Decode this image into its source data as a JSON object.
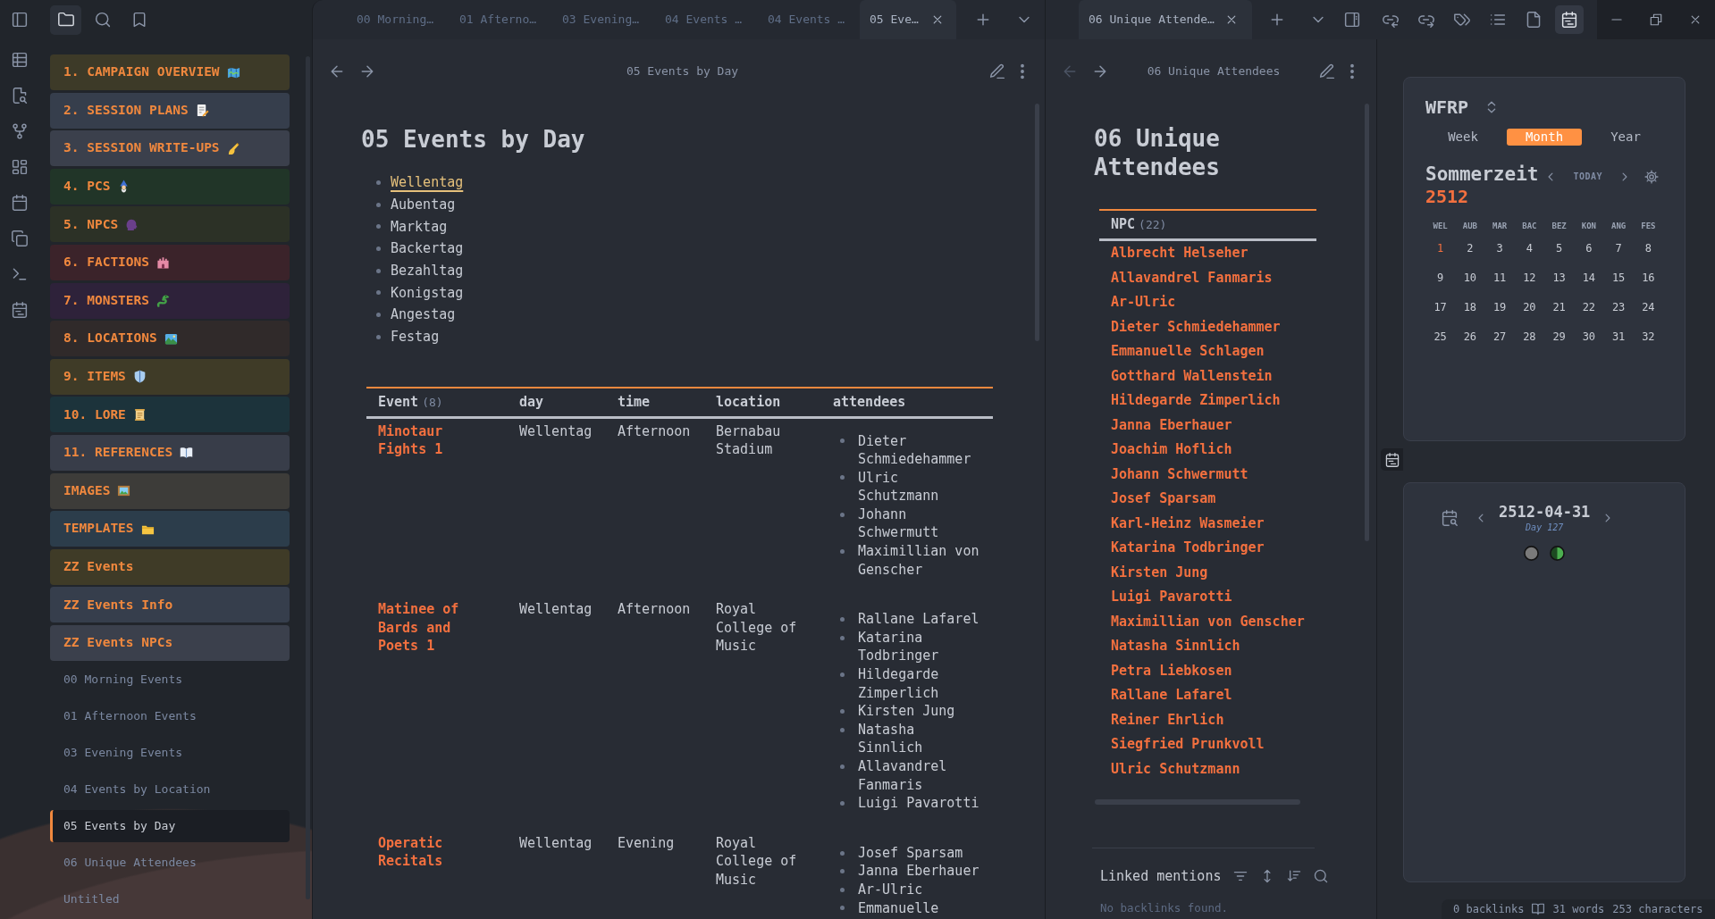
{
  "sidebar_tabs": [
    {
      "kind": "files",
      "selected": true
    },
    {
      "kind": "search",
      "selected": false
    },
    {
      "kind": "bookmarks",
      "selected": false
    }
  ],
  "sidebar": {
    "folders": [
      {
        "label": "1. CAMPAIGN OVERVIEW",
        "color": "#3d3a28"
      },
      {
        "label": "2. SESSION PLANS",
        "color": "#363e4c"
      },
      {
        "label": "3. SESSION WRITE-UPS",
        "color": "#3b404c"
      },
      {
        "label": "4. PCS",
        "color": "#213528"
      },
      {
        "label": "5. NPCS",
        "color": "#2c3126"
      },
      {
        "label": "6. FACTIONS",
        "color": "#3b232a"
      },
      {
        "label": "7. MONSTERS",
        "color": "#2e223a"
      },
      {
        "label": "8. LOCATIONS",
        "color": "#302a2a"
      },
      {
        "label": "9. ITEMS",
        "color": "#3f3b27"
      },
      {
        "label": "10. LORE",
        "color": "#1c333b"
      },
      {
        "label": "11. REFERENCES",
        "color": "#383d49"
      },
      {
        "label": "IMAGES",
        "color": "#3d3c39"
      },
      {
        "label": "TEMPLATES",
        "color": "#2c3d4b"
      },
      {
        "label": "ZZ Events",
        "color": "#3f3b27"
      },
      {
        "label": "ZZ Events Info",
        "color": "#363e4c"
      },
      {
        "label": "ZZ Events NPCs",
        "color": "#3b404c"
      }
    ],
    "files": [
      {
        "label": "00 Morning Events",
        "selected": false
      },
      {
        "label": "01 Afternoon Events",
        "selected": false
      },
      {
        "label": "03 Evening Events",
        "selected": false
      },
      {
        "label": "04 Events by Location",
        "selected": false
      },
      {
        "label": "05 Events by Day",
        "selected": true
      },
      {
        "label": "06 Unique Attendees",
        "selected": false
      },
      {
        "label": "Untitled",
        "selected": false
      }
    ]
  },
  "main_pane": {
    "tabs": [
      {
        "label": "00 Morning…",
        "selected": false
      },
      {
        "label": "01 Afterno…",
        "selected": false
      },
      {
        "label": "03 Evening…",
        "selected": false
      },
      {
        "label": "04 Events …",
        "selected": false
      },
      {
        "label": "04 Events …",
        "selected": false
      },
      {
        "label": "05 Eve…",
        "selected": true
      }
    ],
    "nav": [
      {
        "kind": "back",
        "disabled": false
      },
      {
        "kind": "forward",
        "disabled": false
      }
    ],
    "view_title": "05 Events by Day",
    "heading": "05 Events by Day",
    "days": [
      {
        "label": "Wellentag",
        "linked": true
      },
      {
        "label": "Aubentag",
        "linked": false
      },
      {
        "label": "Marktag",
        "linked": false
      },
      {
        "label": "Backertag",
        "linked": false
      },
      {
        "label": "Bezahltag",
        "linked": false
      },
      {
        "label": "Konigstag",
        "linked": false
      },
      {
        "label": "Angestag",
        "linked": false
      },
      {
        "label": "Festag",
        "linked": false
      }
    ],
    "table": {
      "columns": [
        {
          "label": "Event",
          "count": "(8)",
          "kind": "link"
        },
        {
          "label": "day",
          "kind": "text"
        },
        {
          "label": "time",
          "kind": "text"
        },
        {
          "label": "location",
          "kind": "text"
        },
        {
          "label": "attendees",
          "kind": "list"
        }
      ],
      "rows": [
        {
          "cells": [
            "Minotaur Fights 1",
            "Wellentag",
            "Afternoon",
            "Bernabau Stadium",
            [
              "Dieter Schmiedehammer",
              "Ulric Schutzmann",
              "Johann Schwermutt",
              "Maximillian von Genscher"
            ]
          ]
        },
        {
          "cells": [
            "Matinee of Bards and Poets 1",
            "Wellentag",
            "Afternoon",
            "Royal College of Music",
            [
              "Rallane Lafarel",
              "Katarina Todbringer",
              "Hildegarde Zimperlich",
              "Kirsten Jung",
              "Natasha Sinnlich",
              "Allavandrel Fanmaris",
              "Luigi Pavarotti"
            ]
          ]
        },
        {
          "cells": [
            "Operatic Recitals",
            "Wellentag",
            "Evening",
            "Royal College of Music",
            [
              "Josef Sparsam",
              "Janna Eberhauer",
              "Ar-Ulric",
              "Emmanuelle"
            ]
          ]
        }
      ]
    }
  },
  "side_pane": {
    "tabs": [
      {
        "label": "06 Unique Attende…",
        "selected": true
      }
    ],
    "nav": [
      {
        "kind": "back",
        "disabled": true
      },
      {
        "kind": "forward",
        "disabled": false
      }
    ],
    "view_title": "06 Unique Attendees",
    "heading": "06 Unique Attendees",
    "table": {
      "column": {
        "label": "NPC",
        "count": "(22)"
      },
      "rows": [
        "Albrecht Helseher",
        "Allavandrel Fanmaris",
        "Ar-Ulric",
        "Dieter Schmiedehammer",
        "Emmanuelle Schlagen",
        "Gotthard Wallenstein",
        "Hildegarde Zimperlich",
        "Janna Eberhauer",
        "Joachim Hoflich",
        "Johann Schwermutt",
        "Josef Sparsam",
        "Karl-Heinz Wasmeier",
        "Katarina Todbringer",
        "Kirsten Jung",
        "Luigi Pavarotti",
        "Maximillian von Genscher",
        "Natasha Sinnlich",
        "Petra Liebkosen",
        "Rallane Lafarel",
        "Reiner Ehrlich",
        "Siegfried Prunkvoll",
        "Ulric Schutzmann"
      ]
    },
    "linked_mentions": {
      "title": "Linked mentions",
      "empty_text": "No backlinks found."
    }
  },
  "right_sidebar_tabs": [
    {
      "kind": "incoming-links",
      "selected": false
    },
    {
      "kind": "outgoing-links",
      "selected": false
    },
    {
      "kind": "tags",
      "selected": false
    },
    {
      "kind": "outline",
      "selected": false
    },
    {
      "kind": "file",
      "selected": false
    },
    {
      "kind": "calendar",
      "selected": true
    }
  ],
  "calendar": {
    "name": "WFRP",
    "views": [
      {
        "label": "Week",
        "selected": false
      },
      {
        "label": "Month",
        "selected": true
      },
      {
        "label": "Year",
        "selected": false
      }
    ],
    "month": "Sommerzeit",
    "year": "2512",
    "today_button": "TODAY",
    "weekdays": [
      "WEL",
      "AUB",
      "MAR",
      "BAC",
      "BEZ",
      "KON",
      "ANG",
      "FES"
    ],
    "days": [
      {
        "label": "1",
        "today": true
      },
      {
        "label": "2",
        "today": false
      },
      {
        "label": "3",
        "today": false
      },
      {
        "label": "4",
        "today": false
      },
      {
        "label": "5",
        "today": false
      },
      {
        "label": "6",
        "today": false
      },
      {
        "label": "7",
        "today": false
      },
      {
        "label": "8",
        "today": false
      },
      {
        "label": "9",
        "today": false
      },
      {
        "label": "10",
        "today": false
      },
      {
        "label": "11",
        "today": false
      },
      {
        "label": "12",
        "today": false
      },
      {
        "label": "13",
        "today": false
      },
      {
        "label": "14",
        "today": false
      },
      {
        "label": "15",
        "today": false
      },
      {
        "label": "16",
        "today": false
      },
      {
        "label": "17",
        "today": false
      },
      {
        "label": "18",
        "today": false
      },
      {
        "label": "19",
        "today": false
      },
      {
        "label": "20",
        "today": false
      },
      {
        "label": "21",
        "today": false
      },
      {
        "label": "22",
        "today": false
      },
      {
        "label": "23",
        "today": false
      },
      {
        "label": "24",
        "today": false
      },
      {
        "label": "25",
        "today": false
      },
      {
        "label": "26",
        "today": false
      },
      {
        "label": "27",
        "today": false
      },
      {
        "label": "28",
        "today": false
      },
      {
        "label": "29",
        "today": false
      },
      {
        "label": "30",
        "today": false
      },
      {
        "label": "31",
        "today": false
      },
      {
        "label": "32",
        "today": false
      }
    ]
  },
  "day_view": {
    "date": "2512-04-31",
    "day_number": "Day 127",
    "moons": [
      {
        "kind": "full",
        "color": "#7a7a7a"
      },
      {
        "kind": "half",
        "color": "#4caf50"
      }
    ]
  },
  "status_bar": {
    "backlinks": "0 backlinks",
    "words": "31 words",
    "characters": "253 characters"
  }
}
